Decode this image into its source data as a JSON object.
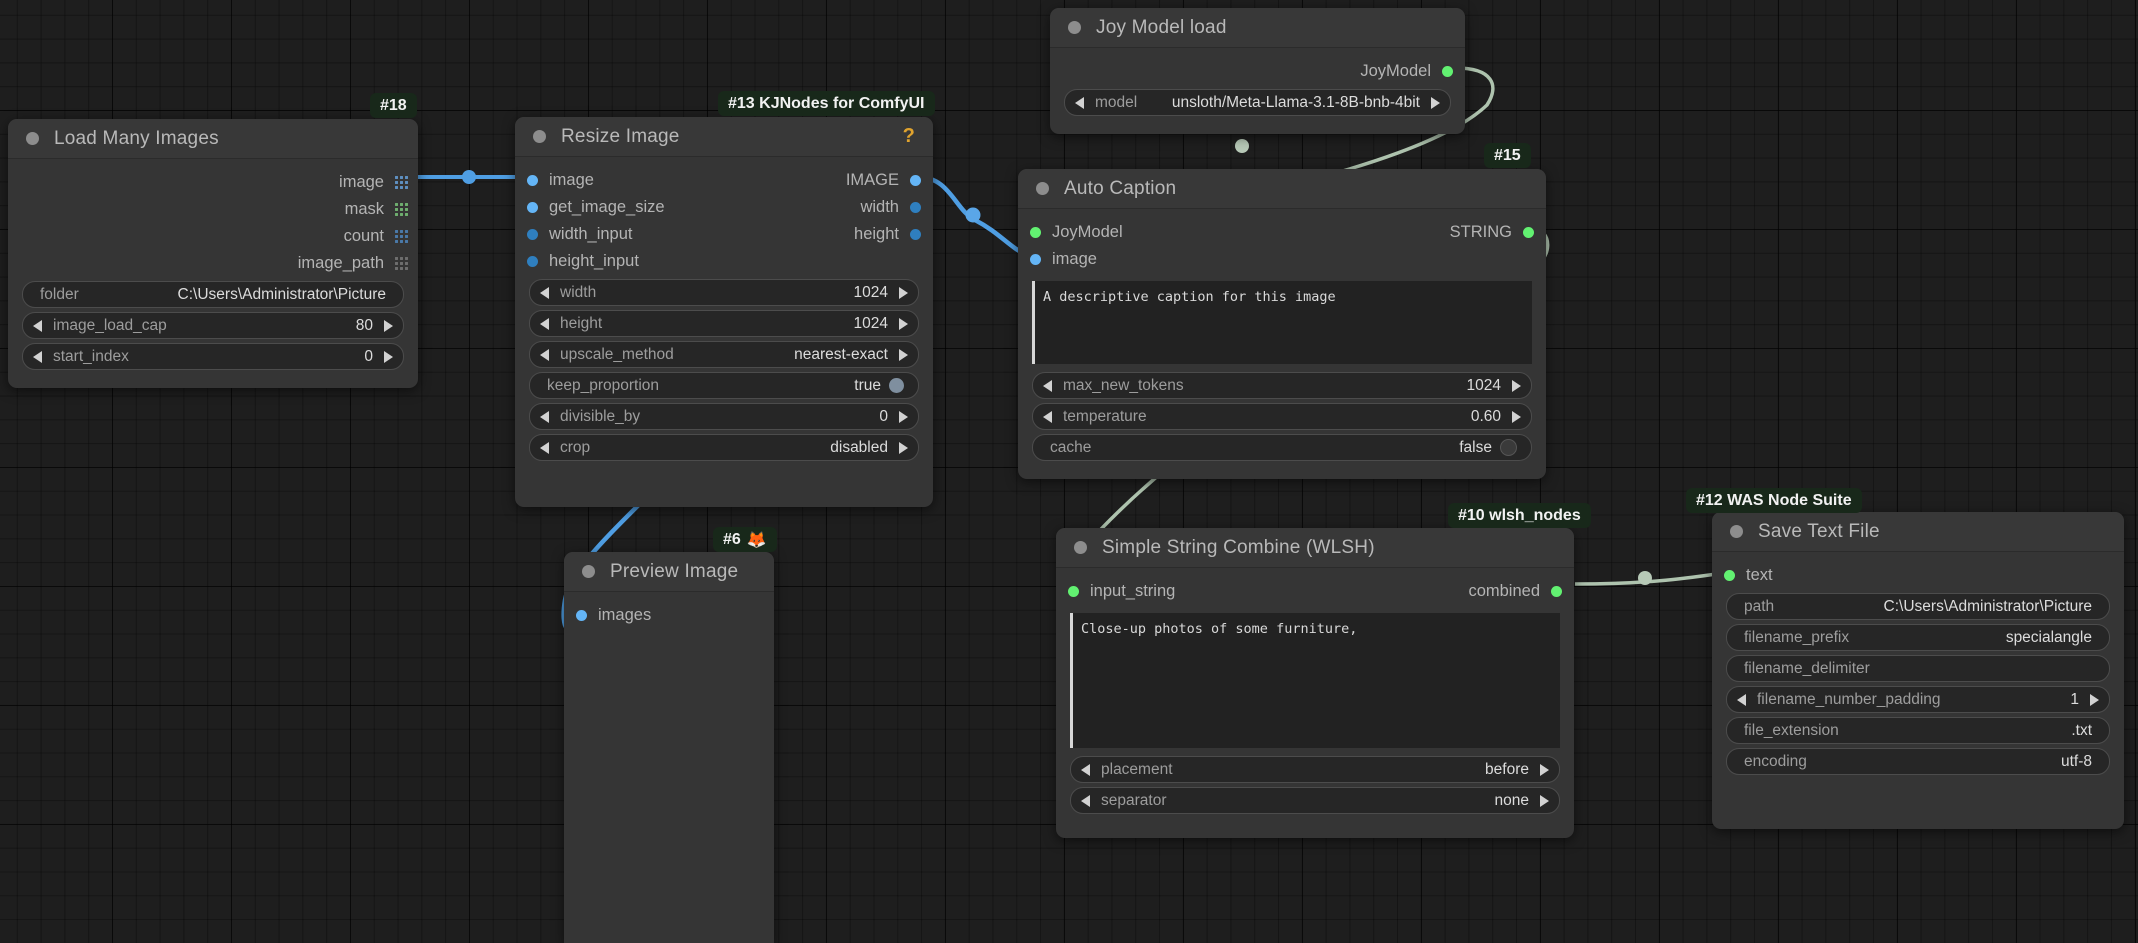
{
  "app": {
    "name": "ComfyUI",
    "canvas_bg": "#1e1e1e",
    "node_bg": "#353535",
    "badge_bg": "#18281a"
  },
  "nodes": {
    "load_many_images": {
      "badge": "#18",
      "title": "Load Many Images",
      "outputs": [
        {
          "label": "image",
          "icon": "grid-dots-icon",
          "color": "#5e8fc0"
        },
        {
          "label": "mask",
          "icon": "grid-dots-icon",
          "color": "#6fae6f"
        },
        {
          "label": "count",
          "icon": "grid-dots-icon",
          "color": "#4a79a8"
        },
        {
          "label": "image_path",
          "icon": "grid-dots-icon",
          "color": "#6e6e6e"
        }
      ],
      "widgets": [
        {
          "name": "folder",
          "value": "C:\\Users\\Administrator\\Picture",
          "arrows": false
        },
        {
          "name": "image_load_cap",
          "value": "80",
          "arrows": true
        },
        {
          "name": "start_index",
          "value": "0",
          "arrows": true
        }
      ]
    },
    "resize_image": {
      "badge": "#13 KJNodes for ComfyUI",
      "title": "Resize Image",
      "help_icon": "?",
      "inputs": [
        {
          "label": "image",
          "color": "#64b5f6"
        },
        {
          "label": "get_image_size",
          "color": "#64b5f6"
        },
        {
          "label": "width_input",
          "color": "#2f7fbf"
        },
        {
          "label": "height_input",
          "color": "#2f7fbf"
        }
      ],
      "outputs": [
        {
          "label": "IMAGE",
          "color": "#64b5f6"
        },
        {
          "label": "width",
          "color": "#2f7fbf"
        },
        {
          "label": "height",
          "color": "#2f7fbf"
        }
      ],
      "widgets": [
        {
          "name": "width",
          "value": "1024",
          "arrows": true
        },
        {
          "name": "height",
          "value": "1024",
          "arrows": true
        },
        {
          "name": "upscale_method",
          "value": "nearest-exact",
          "arrows": true
        },
        {
          "name": "keep_proportion",
          "value": "true",
          "arrows": false,
          "toggle": "on"
        },
        {
          "name": "divisible_by",
          "value": "0",
          "arrows": true
        },
        {
          "name": "crop",
          "value": "disabled",
          "arrows": true
        }
      ]
    },
    "joy_model_load": {
      "title": "Joy Model load",
      "outputs": [
        {
          "label": "JoyModel",
          "color": "#62f171"
        }
      ],
      "widgets": [
        {
          "name": "model",
          "value": "unsloth/Meta-Llama-3.1-8B-bnb-4bit",
          "arrows": true
        }
      ]
    },
    "auto_caption": {
      "badge": "#15",
      "title": "Auto Caption",
      "inputs": [
        {
          "label": "JoyModel",
          "color": "#62f171"
        },
        {
          "label": "image",
          "color": "#64b5f6"
        }
      ],
      "outputs": [
        {
          "label": "STRING",
          "color": "#62f171"
        }
      ],
      "text": "A descriptive caption for this image",
      "widgets": [
        {
          "name": "max_new_tokens",
          "value": "1024",
          "arrows": true
        },
        {
          "name": "temperature",
          "value": "0.60",
          "arrows": true
        },
        {
          "name": "cache",
          "value": "false",
          "arrows": false,
          "toggle": "off"
        }
      ]
    },
    "preview_image": {
      "badge": "#6",
      "badge_emoji": "🦊",
      "title": "Preview Image",
      "inputs": [
        {
          "label": "images",
          "color": "#64b5f6"
        }
      ]
    },
    "simple_string_combine": {
      "badge": "#10 wlsh_nodes",
      "title": "Simple String Combine (WLSH)",
      "inputs": [
        {
          "label": "input_string",
          "color": "#62f171"
        }
      ],
      "outputs": [
        {
          "label": "combined",
          "color": "#62f171"
        }
      ],
      "text": "Close-up photos of some furniture,",
      "widgets": [
        {
          "name": "placement",
          "value": "before",
          "arrows": true
        },
        {
          "name": "separator",
          "value": "none",
          "arrows": true
        }
      ]
    },
    "save_text_file": {
      "badge": "#12 WAS Node Suite",
      "title": "Save Text File",
      "inputs": [
        {
          "label": "text",
          "color": "#62f171"
        }
      ],
      "widgets": [
        {
          "name": "path",
          "value": "C:\\Users\\Administrator\\Picture",
          "arrows": false
        },
        {
          "name": "filename_prefix",
          "value": "specialangle",
          "arrows": false
        },
        {
          "name": "filename_delimiter",
          "value": "",
          "arrows": false
        },
        {
          "name": "filename_number_padding",
          "value": "1",
          "arrows": true
        },
        {
          "name": "file_extension",
          "value": ".txt",
          "arrows": false
        },
        {
          "name": "encoding",
          "value": "utf-8",
          "arrows": false
        }
      ]
    }
  },
  "links": {
    "image_color": "#4f9ee3",
    "string_color": "#aec3ae"
  }
}
